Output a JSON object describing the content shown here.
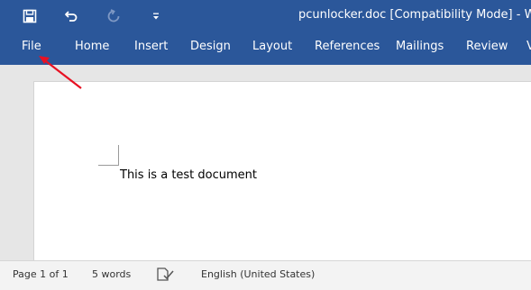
{
  "app": {
    "title": "pcunlocker.doc [Compatibility Mode]  -  Word",
    "accent_color": "#2b579a"
  },
  "quick_access": [
    {
      "name": "save-icon"
    },
    {
      "name": "undo-icon"
    },
    {
      "name": "redo-icon"
    },
    {
      "name": "customize-qat-icon"
    }
  ],
  "ribbon": {
    "tabs": [
      "File",
      "Home",
      "Insert",
      "Design",
      "Layout",
      "References",
      "Mailings",
      "Review",
      "V"
    ]
  },
  "document": {
    "text": "This is a test document"
  },
  "annotation": {
    "color": "#e81123",
    "icon": "red-arrow-pointing-to-file-tab"
  },
  "status": {
    "page": "Page 1 of 1",
    "words": "5 words",
    "proofing_icon": "proofing-check-icon",
    "language": "English (United States)"
  }
}
